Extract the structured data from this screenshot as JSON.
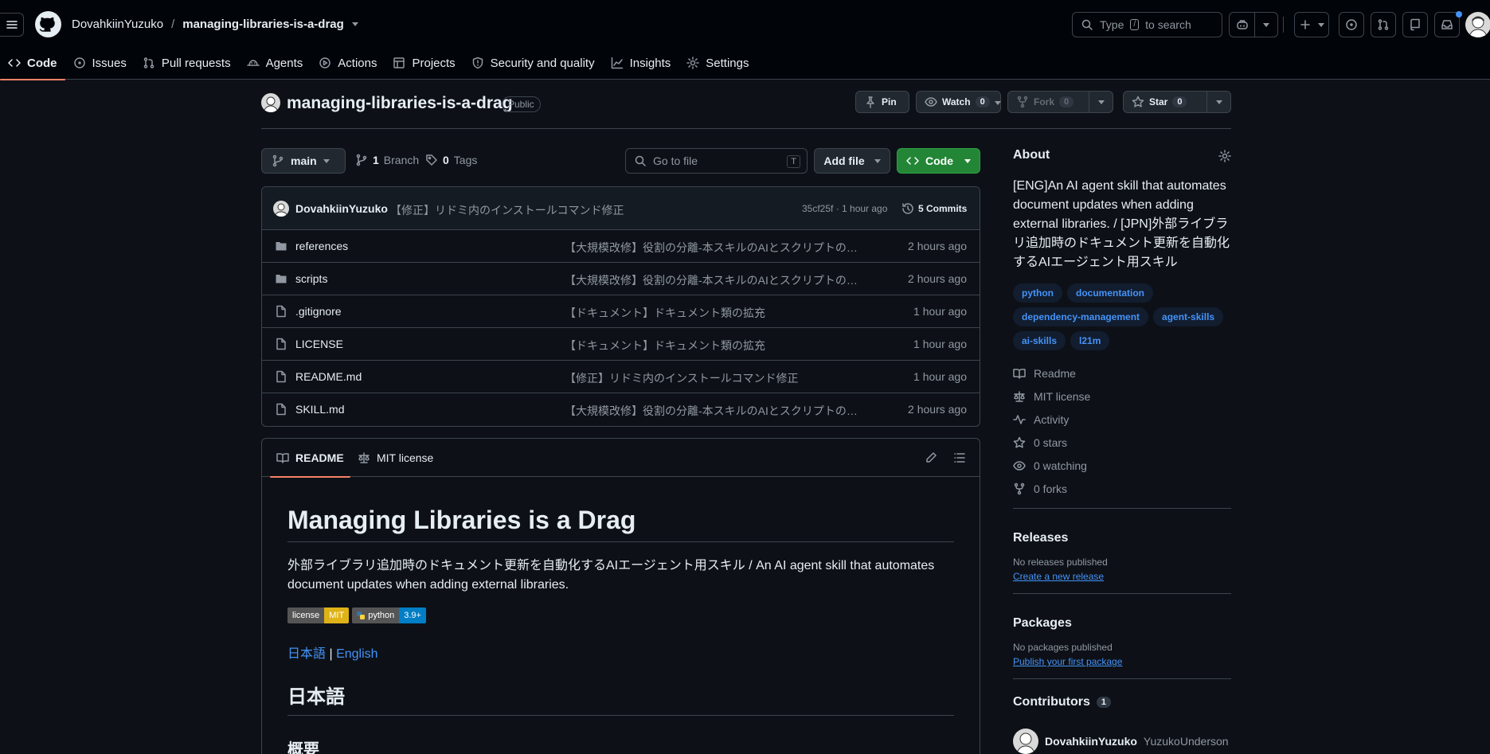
{
  "header": {
    "owner": "DovahkiinYuzuko",
    "separator": "/",
    "repo": "managing-libraries-is-a-drag",
    "search_prefix": "Type",
    "search_key": "/",
    "search_suffix": "to search"
  },
  "nav_tabs": [
    {
      "label": "Code",
      "icon": "code-icon"
    },
    {
      "label": "Issues",
      "icon": "issue-icon"
    },
    {
      "label": "Pull requests",
      "icon": "pull-request-icon"
    },
    {
      "label": "Agents",
      "icon": "agent-icon"
    },
    {
      "label": "Actions",
      "icon": "play-icon"
    },
    {
      "label": "Projects",
      "icon": "table-icon"
    },
    {
      "label": "Security and quality",
      "icon": "shield-icon"
    },
    {
      "label": "Insights",
      "icon": "graph-icon"
    },
    {
      "label": "Settings",
      "icon": "gear-icon"
    }
  ],
  "repo_title": {
    "name": "managing-libraries-is-a-drag",
    "visibility": "Public",
    "pin_label": "Pin",
    "watch_label": "Watch",
    "watch_count": "0",
    "fork_label": "Fork",
    "fork_count": "0",
    "star_label": "Star",
    "star_count": "0"
  },
  "file_nav": {
    "branch": "main",
    "branch_count": "1",
    "branch_label": "Branch",
    "tag_count": "0",
    "tag_label": "Tags",
    "goto_placeholder": "Go to file",
    "goto_key": "T",
    "add_file_label": "Add file",
    "code_label": "Code"
  },
  "latest_commit": {
    "author": "DovahkiinYuzuko",
    "message": "【修正】リドミ内のインストールコマンド修正",
    "sha_age": "35cf25f · 1 hour ago",
    "commits_label": "5 Commits"
  },
  "files": [
    {
      "name": "references",
      "type": "folder",
      "message": "【大規模改修】役割の分離-本スキルのAIとスクリプトの役割を明確化",
      "age": "2 hours ago"
    },
    {
      "name": "scripts",
      "type": "folder",
      "message": "【大規模改修】役割の分離-本スキルのAIとスクリプトの役割を明確化",
      "age": "2 hours ago"
    },
    {
      "name": ".gitignore",
      "type": "file",
      "message": "【ドキュメント】ドキュメント類の拡充",
      "age": "1 hour ago"
    },
    {
      "name": "LICENSE",
      "type": "file",
      "message": "【ドキュメント】ドキュメント類の拡充",
      "age": "1 hour ago"
    },
    {
      "name": "README.md",
      "type": "file",
      "message": "【修正】リドミ内のインストールコマンド修正",
      "age": "1 hour ago"
    },
    {
      "name": "SKILL.md",
      "type": "file",
      "message": "【大規模改修】役割の分離-本スキルのAIとスクリプトの役割を明確化",
      "age": "2 hours ago"
    }
  ],
  "readme": {
    "tab_readme": "README",
    "tab_license": "MIT license",
    "title": "Managing Libraries is a Drag",
    "intro": "外部ライブラリ追加時のドキュメント更新を自動化するAIエージェント用スキル / An AI agent skill that automates document updates when adding external libraries.",
    "badge_license_left": "license",
    "badge_license_right": "MIT",
    "badge_python_left": "python",
    "badge_python_right": "3.9+",
    "link_ja": "日本語",
    "link_sep": "|",
    "link_en": "English",
    "h2": "日本語",
    "h3": "概要",
    "colors": {
      "mit": "#dfb317",
      "python": "#007ec6"
    }
  },
  "sidebar": {
    "about_title": "About",
    "description": "[ENG]An AI agent skill that automates document updates when adding external libraries. / [JPN]外部ライブラリ追加時のドキュメント更新を自動化するAIエージェント用スキル",
    "topics": [
      "python",
      "documentation",
      "dependency-management",
      "agent-skills",
      "ai-skills",
      "l21m"
    ],
    "links": [
      {
        "label": "Readme",
        "icon": "book-icon"
      },
      {
        "label": "MIT license",
        "icon": "law-icon"
      },
      {
        "label": "Activity",
        "icon": "pulse-icon"
      },
      {
        "label": "0 stars",
        "icon": "star-icon"
      },
      {
        "label": "0 watching",
        "icon": "eye-icon"
      },
      {
        "label": "0 forks",
        "icon": "fork-icon"
      }
    ],
    "releases_title": "Releases",
    "releases_none": "No releases published",
    "releases_link": "Create a new release",
    "packages_title": "Packages",
    "packages_none": "No packages published",
    "packages_link": "Publish your first package",
    "contributors_title": "Contributors",
    "contributors_count": "1",
    "contributor_name": "DovahkiinYuzuko",
    "contributor_alt": "YuzukoUnderson"
  }
}
